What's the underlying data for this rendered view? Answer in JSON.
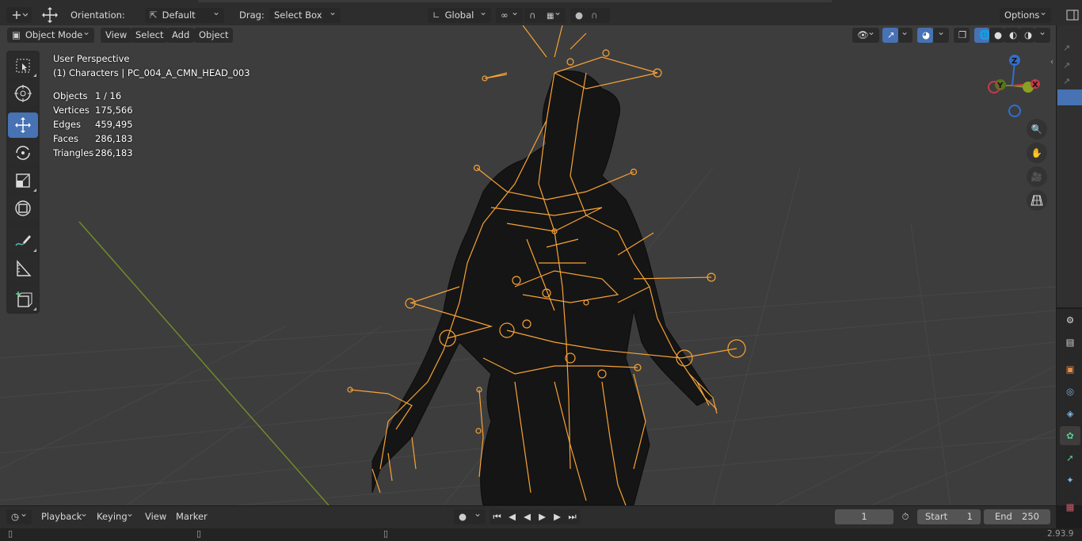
{
  "header": {
    "orientation_label": "Orientation:",
    "orientation_value": "Default",
    "drag_label": "Drag:",
    "drag_value": "Select Box",
    "transform_space": "Global",
    "options_label": "Options"
  },
  "viewport_header": {
    "mode": "Object Mode",
    "menus": [
      "View",
      "Select",
      "Add",
      "Object"
    ]
  },
  "overlay": {
    "perspective": "User Perspective",
    "object_path": "(1) Characters | PC_004_A_CMN_HEAD_003",
    "stats": [
      {
        "label": "Objects",
        "value": "1 / 16"
      },
      {
        "label": "Vertices",
        "value": "175,566"
      },
      {
        "label": "Edges",
        "value": "459,495"
      },
      {
        "label": "Faces",
        "value": "286,183"
      },
      {
        "label": "Triangles",
        "value": "286,183"
      }
    ]
  },
  "gizmo": {
    "z": "Z",
    "y": "Y",
    "x": "X"
  },
  "timeline": {
    "menus": [
      "Playback",
      "Keying",
      "View",
      "Marker"
    ],
    "current_frame": "1",
    "start_label": "Start",
    "start_value": "1",
    "end_label": "End",
    "end_value": "250"
  },
  "status": {
    "version": "2.93.9"
  },
  "colors": {
    "accent": "#4772b3",
    "bone": "#f7a236",
    "background": "#3d3d3d",
    "grid": "#4a4a4a",
    "y_axis_line": "#6f8a2b"
  },
  "icons": [
    "cursor-select-icon",
    "cursor-icon",
    "move-icon",
    "rotate-icon",
    "scale-icon",
    "transform-icon",
    "annotate-icon",
    "measure-icon",
    "add-cube-icon"
  ]
}
